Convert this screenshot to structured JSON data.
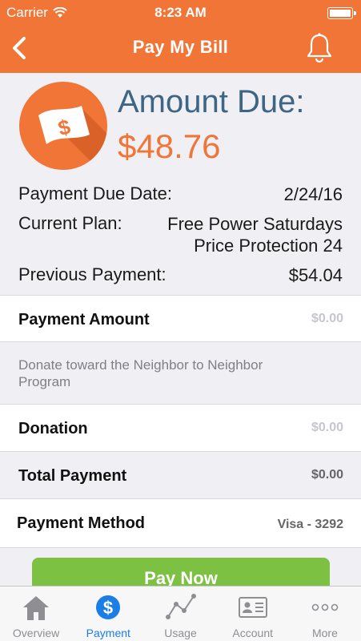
{
  "status": {
    "carrier": "Carrier",
    "time": "8:23 AM"
  },
  "nav": {
    "title": "Pay My Bill"
  },
  "summary": {
    "amount_label": "Amount Due:",
    "amount_value": "$48.76",
    "due_date_label": "Payment Due Date:",
    "due_date_value": "2/24/16",
    "plan_label": "Current Plan:",
    "plan_line1": "Free Power Saturdays",
    "plan_line2": "Price Protection 24",
    "prev_label": "Previous Payment:",
    "prev_value": "$54.04"
  },
  "form": {
    "payment_amount_label": "Payment Amount",
    "payment_amount_value": "$0.00",
    "donate_note": "Donate toward the Neighbor to Neighbor Program",
    "donation_label": "Donation",
    "donation_value": "$0.00",
    "total_label": "Total Payment",
    "total_value": "$0.00",
    "method_label": "Payment Method",
    "method_value": "Visa - 3292"
  },
  "pay_button": "Pay Now",
  "tabs": [
    {
      "label": "Overview",
      "icon": "home-icon"
    },
    {
      "label": "Payment",
      "icon": "dollar-icon"
    },
    {
      "label": "Usage",
      "icon": "graph-icon"
    },
    {
      "label": "Account",
      "icon": "id-card-icon"
    },
    {
      "label": "More",
      "icon": "more-icon"
    }
  ],
  "colors": {
    "brand": "#f07537",
    "accent_blue": "#3e6584",
    "pay_green": "#7cc142",
    "tab_active": "#1a7ee6"
  }
}
